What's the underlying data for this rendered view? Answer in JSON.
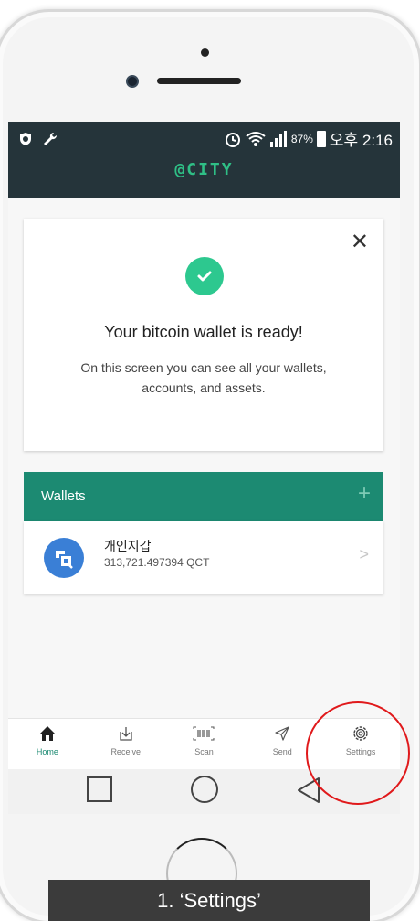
{
  "status_bar": {
    "battery_percent": "87%",
    "time": "오후 2:16"
  },
  "app": {
    "brand": "@CITY"
  },
  "ready_card": {
    "title": "Your bitcoin wallet is ready!",
    "description": "On this screen you can see all your wallets, accounts, and assets.",
    "close_icon": "close-icon",
    "success_color": "#2dc88f"
  },
  "wallets": {
    "title": "Wallets",
    "add_label": "+",
    "header_color": "#1c8a72",
    "items": [
      {
        "name": "개인지갑",
        "balance": "313,721.497394 QCT",
        "avatar_color": "#3a7fd6"
      }
    ]
  },
  "bottom_nav": {
    "items": [
      {
        "label": "Home",
        "icon": "home-icon",
        "active": true
      },
      {
        "label": "Receive",
        "icon": "receive-icon",
        "active": false
      },
      {
        "label": "Scan",
        "icon": "barcode-icon",
        "active": false
      },
      {
        "label": "Send",
        "icon": "send-icon",
        "active": false
      },
      {
        "label": "Settings",
        "icon": "gear-icon",
        "active": false
      }
    ]
  },
  "annotation": {
    "caption": "1. ‘Settings’",
    "highlight_color": "#e0191b"
  }
}
